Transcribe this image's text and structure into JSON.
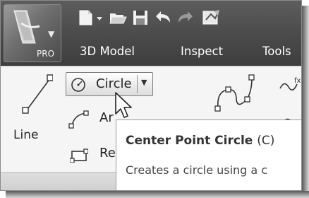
{
  "app_menu": {
    "label": "PRO",
    "icon": "inventor-logo-icon"
  },
  "quick_access": [
    {
      "name": "new-file-icon"
    },
    {
      "name": "dropdown-arrow-icon"
    },
    {
      "name": "open-folder-icon"
    },
    {
      "name": "save-icon"
    },
    {
      "name": "undo-icon"
    },
    {
      "name": "redo-icon"
    },
    {
      "name": "update-icon"
    }
  ],
  "tabs": [
    {
      "label": "3D Model"
    },
    {
      "label": "Inspect"
    },
    {
      "label": "Tools"
    }
  ],
  "ribbon": {
    "line": {
      "label": "Line"
    },
    "circle": {
      "label": "Circle"
    },
    "arc": {
      "label": "Ar"
    },
    "rectangle": {
      "label": "Re"
    }
  },
  "tooltip": {
    "title": "Center Point Circle",
    "shortcut": "(C)",
    "description": "Creates a circle using a c"
  },
  "colors": {
    "topbar": "#4a4a4a",
    "ribbon": "#f5f5f5",
    "tooltip_bg": "#ffffff"
  }
}
